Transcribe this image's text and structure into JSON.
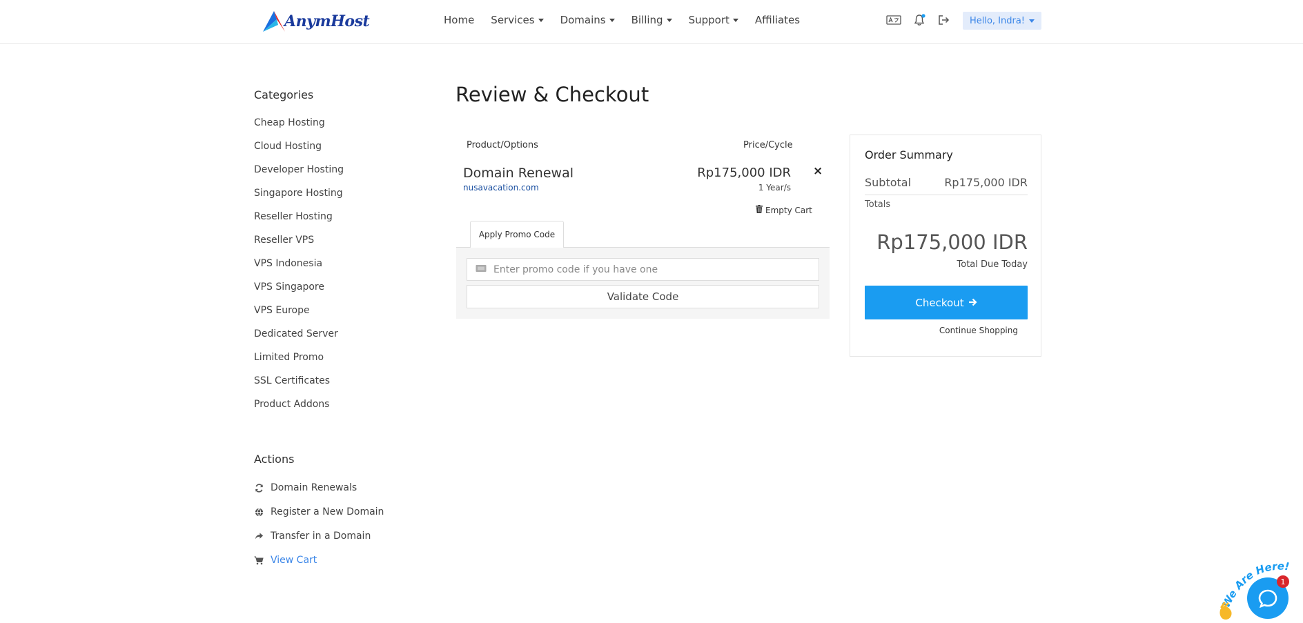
{
  "header": {
    "brand": "AnymHost",
    "nav": [
      {
        "label": "Home",
        "dropdown": false
      },
      {
        "label": "Services",
        "dropdown": true
      },
      {
        "label": "Domains",
        "dropdown": true
      },
      {
        "label": "Billing",
        "dropdown": true
      },
      {
        "label": "Support",
        "dropdown": true
      },
      {
        "label": "Affiliates",
        "dropdown": false
      }
    ],
    "icons": [
      "language-icon",
      "notification-bell-icon",
      "logout-icon"
    ],
    "user_greeting": "Hello, Indra!"
  },
  "sidebar": {
    "categories_title": "Categories",
    "categories": [
      "Cheap Hosting",
      "Cloud Hosting",
      "Developer Hosting",
      "Singapore Hosting",
      "Reseller Hosting",
      "Reseller VPS",
      "VPS Indonesia",
      "VPS Singapore",
      "VPS Europe",
      "Dedicated Server",
      "Limited Promo",
      "SSL Certificates",
      "Product Addons"
    ],
    "actions_title": "Actions",
    "actions": [
      {
        "label": "Domain Renewals",
        "icon": "refresh-icon"
      },
      {
        "label": "Register a New Domain",
        "icon": "globe-icon"
      },
      {
        "label": "Transfer in a Domain",
        "icon": "share-arrow-icon"
      },
      {
        "label": "View Cart",
        "icon": "cart-icon"
      }
    ]
  },
  "main": {
    "title": "Review & Checkout",
    "col_product": "Product/Options",
    "col_price": "Price/Cycle",
    "item": {
      "name": "Domain Renewal",
      "domain": "nusavacation.com",
      "price": "Rp175,000 IDR",
      "cycle": "1 Year/s",
      "remove": "×"
    },
    "empty_cart": "Empty Cart",
    "promo_tab": "Apply Promo Code",
    "promo_placeholder": "Enter promo code if you have one",
    "validate_label": "Validate Code"
  },
  "summary": {
    "title": "Order Summary",
    "subtotal_label": "Subtotal",
    "subtotal_value": "Rp175,000 IDR",
    "totals_label": "Totals",
    "total_value": "Rp175,000 IDR",
    "due_label": "Total Due Today",
    "checkout_label": "Checkout",
    "continue_label": "Continue Shopping"
  },
  "chat": {
    "tagline": "We Are Here!",
    "badge": "1"
  },
  "colors": {
    "accent": "#1a9cf1",
    "link": "#3b86e8",
    "brand": "#1a3a9c",
    "badge": "#d9262b"
  }
}
